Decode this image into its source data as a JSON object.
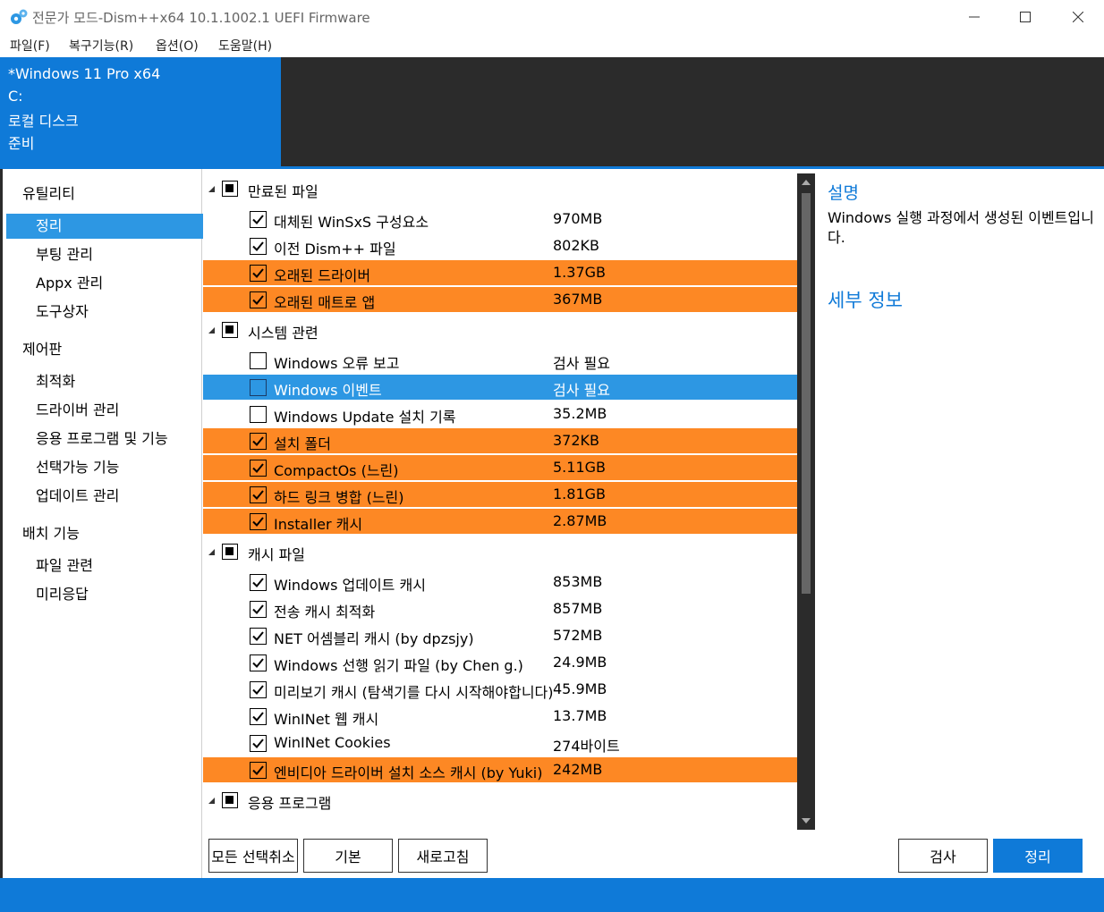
{
  "window": {
    "title": "전문가 모드-Dism++x64 10.1.1002.1 UEFI Firmware",
    "minimize_label": "—",
    "maximize_label": "☐",
    "close_label": "✕"
  },
  "menu": [
    "파일(F)",
    "복구기능(R)",
    "옵션(O)",
    "도움말(H)"
  ],
  "image_info": {
    "name": "*Windows 11 Pro x64",
    "drive": "C:",
    "disk": "로컬 디스크",
    "status": "준비"
  },
  "nav": {
    "categories": [
      {
        "label": "유틸리티",
        "items": [
          "정리",
          "부팅 관리",
          "Appx 관리",
          "도구상자"
        ]
      },
      {
        "label": "제어판",
        "items": [
          "최적화",
          "드라이버 관리",
          "응용 프로그램 및 기능",
          "선택가능 기능",
          "업데이트 관리"
        ]
      },
      {
        "label": "배치 기능",
        "items": [
          "파일 관련",
          "미리응답"
        ]
      }
    ],
    "active_item": "정리"
  },
  "groups": [
    {
      "label": "만료된 파일",
      "items": [
        {
          "label": "대체된 WinSxS 구성요소",
          "size": "970MB",
          "checked": true,
          "highlight": "none"
        },
        {
          "label": "이전 Dism++ 파일",
          "size": "802KB",
          "checked": true,
          "highlight": "none"
        },
        {
          "label": "오래된 드라이버",
          "size": "1.37GB",
          "checked": true,
          "highlight": "orange"
        },
        {
          "label": "오래된 매트로 앱",
          "size": "367MB",
          "checked": true,
          "highlight": "orange"
        }
      ]
    },
    {
      "label": "시스템 관련",
      "items": [
        {
          "label": "Windows 오류 보고",
          "size": "검사 필요",
          "checked": false,
          "highlight": "none"
        },
        {
          "label": "Windows 이벤트",
          "size": "검사 필요",
          "checked": false,
          "highlight": "selected"
        },
        {
          "label": "Windows Update 설치 기록",
          "size": "35.2MB",
          "checked": false,
          "highlight": "none"
        },
        {
          "label": "설치 폴더",
          "size": "372KB",
          "checked": true,
          "highlight": "orange"
        },
        {
          "label": "CompactOs (느린)",
          "size": "5.11GB",
          "checked": true,
          "highlight": "orange"
        },
        {
          "label": "하드 링크 병합 (느린)",
          "size": "1.81GB",
          "checked": true,
          "highlight": "orange"
        },
        {
          "label": "Installer 캐시",
          "size": "2.87MB",
          "checked": true,
          "highlight": "orange"
        }
      ]
    },
    {
      "label": "캐시 파일",
      "items": [
        {
          "label": "Windows 업데이트 캐시",
          "size": "853MB",
          "checked": true,
          "highlight": "none"
        },
        {
          "label": "전송 캐시 최적화",
          "size": "857MB",
          "checked": true,
          "highlight": "none"
        },
        {
          "label": "NET 어셈블리 캐시 (by dpzsjy)",
          "size": "572MB",
          "checked": true,
          "highlight": "none"
        },
        {
          "label": "Windows 선행 읽기 파일 (by Chen g.)",
          "size": "24.9MB",
          "checked": true,
          "highlight": "none"
        },
        {
          "label": "미리보기 캐시 (탐색기를 다시 시작해야합니다)",
          "size": "45.9MB",
          "checked": true,
          "highlight": "none"
        },
        {
          "label": "WinINet 웹 캐시",
          "size": "13.7MB",
          "checked": true,
          "highlight": "none"
        },
        {
          "label": "WinINet Cookies",
          "size": "274바이트",
          "checked": true,
          "highlight": "none"
        },
        {
          "label": "엔비디아 드라이버 설치 소스 캐시 (by Yuki)",
          "size": "242MB",
          "checked": true,
          "highlight": "orange"
        }
      ]
    },
    {
      "label": "응용 프로그램",
      "items": []
    }
  ],
  "panel": {
    "title": "설명",
    "description": "Windows 실행 과정에서 생성된 이벤트입니다.",
    "details_link": "세부 정보"
  },
  "buttons": {
    "deselect_all": "모든 선택취소",
    "default": "기본",
    "refresh": "새로고침",
    "scan": "검사",
    "clean": "정리"
  },
  "colors": {
    "accent": "#0f7ad8",
    "highlight_orange": "#fd8824",
    "selection_blue": "#2d97e3",
    "header_dark": "#2b2b2b"
  }
}
